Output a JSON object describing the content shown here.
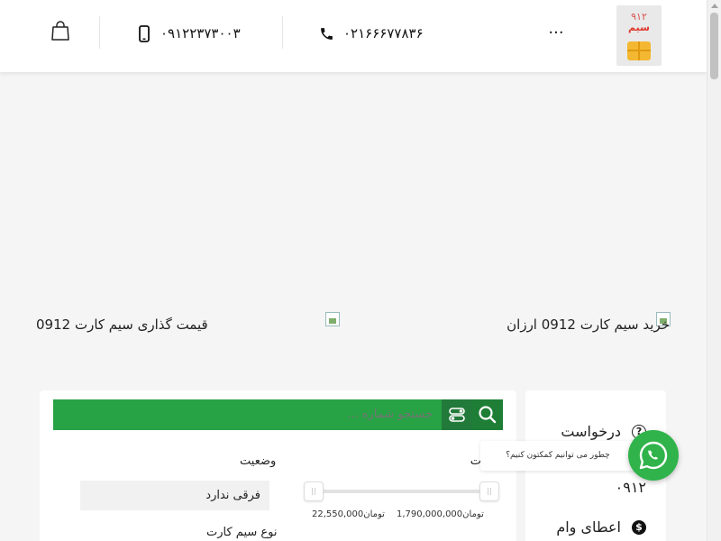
{
  "header": {
    "logo": {
      "number": "۹۱۲",
      "word": "سیم"
    },
    "more_label": "···",
    "phone_landline": "۰۲۱۶۶۶۷۷۸۳۶",
    "phone_mobile": "۰۹۱۲۲۳۷۳۰۰۳",
    "icons": [
      "more-icon",
      "phone-handset-icon",
      "mobile-phone-icon",
      "shopping-bag-icon"
    ]
  },
  "banners": {
    "right": "خرید سیم کارت 0912 ارزان",
    "left": "قیمت گذاری سیم کارت 0912"
  },
  "sidebar": {
    "items": [
      {
        "label": "درخواست",
        "icon": "question-circle-icon"
      },
      {
        "label": "۰۹۱۲",
        "icon": ""
      },
      {
        "label": "اعطای وام",
        "icon": "dollar-circle-icon"
      }
    ]
  },
  "search": {
    "placeholder": "جستجو شماره ..."
  },
  "filters": {
    "price_label_partial": "ت",
    "status_label": "وضعیت",
    "status_value": "فرقی ندارد",
    "sim_type_label": "نوع سیم کارت",
    "price_max": "1,790,000,000",
    "price_min": "22,550,000",
    "currency": "تومان"
  },
  "whatsapp": {
    "bubble_text": "چطور می توانیم کمکتون کنیم؟"
  },
  "colors": {
    "green": "#27a245",
    "dark_green": "#1e7e36",
    "whatsapp": "#2fb34a"
  }
}
